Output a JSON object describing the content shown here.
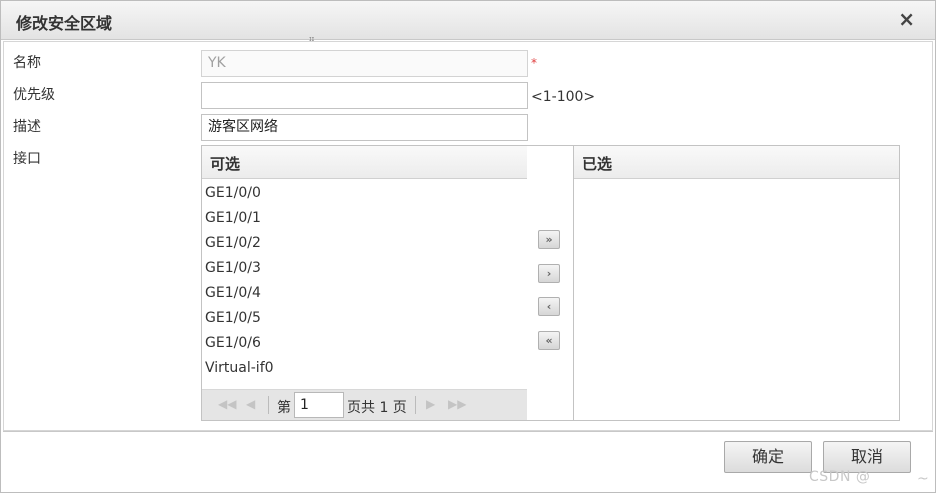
{
  "dialog": {
    "title": "修改安全区域",
    "close_glyph": "×"
  },
  "form": {
    "name_label": "名称",
    "name_value": "YK",
    "required_mark": "*",
    "priority_label": "优先级",
    "priority_value": "",
    "priority_hint": "<1-100>",
    "desc_label": "描述",
    "desc_value": "游客区网络",
    "iface_label": "接口"
  },
  "available": {
    "header": "可选",
    "items": [
      "GE1/0/0",
      "GE1/0/1",
      "GE1/0/2",
      "GE1/0/3",
      "GE1/0/4",
      "GE1/0/5",
      "GE1/0/6",
      "Virtual-if0"
    ]
  },
  "selected": {
    "header": "已选",
    "items": []
  },
  "pager": {
    "page_prefix": "第",
    "page_value": "1",
    "page_suffix": "页共 1 页",
    "icons": [
      "first-page-icon",
      "prev-page-icon",
      "next-page-icon",
      "last-page-icon"
    ]
  },
  "move_buttons": {
    "all_right": "»",
    "right": "›",
    "left": "‹",
    "all_left": "«"
  },
  "footer": {
    "ok_label": "确定",
    "cancel_label": "取消"
  },
  "watermark": "CSDN @",
  "watermark_tail": "~",
  "colors": {
    "required": "#e04040",
    "titlebar": "#e9e9e9",
    "pager_bg": "#e5e5e5"
  }
}
